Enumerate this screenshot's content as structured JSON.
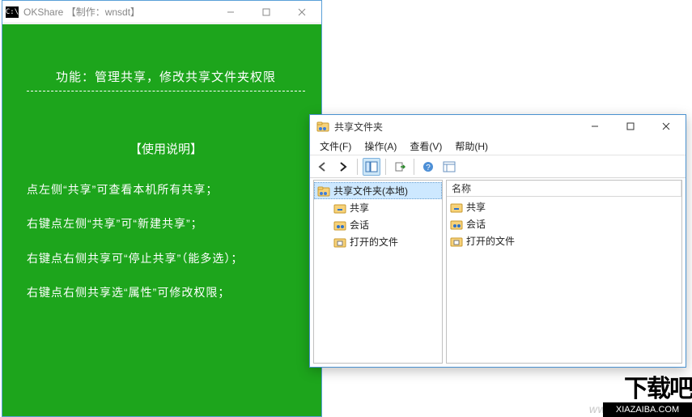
{
  "win1": {
    "title": "OKShare  【制作：wnsdt】",
    "heading": "功能：管理共享，修改共享文件夹权限",
    "usage_heading": "【使用说明】",
    "instructions": [
      "点左侧“共享”可查看本机所有共享；",
      "右键点左侧“共享”可“新建共享”；",
      "右键点右侧共享可“停止共享”（能多选）；",
      "右键点右侧共享选“属性”可修改权限；"
    ]
  },
  "win2": {
    "title": "共享文件夹",
    "menubar": [
      {
        "label": "文件(F)"
      },
      {
        "label": "操作(A)"
      },
      {
        "label": "查看(V)"
      },
      {
        "label": "帮助(H)"
      }
    ],
    "toolbar": [
      {
        "name": "back-icon"
      },
      {
        "name": "forward-icon"
      },
      {
        "sep": true
      },
      {
        "name": "show-hide-tree-icon",
        "selected": true
      },
      {
        "sep": true
      },
      {
        "name": "export-list-icon"
      },
      {
        "sep": true
      },
      {
        "name": "help-icon"
      },
      {
        "name": "properties-icon"
      }
    ],
    "tree": {
      "root": {
        "label": "共享文件夹(本地)",
        "selected": true,
        "icon": "shared-folder-icon"
      },
      "children": [
        {
          "label": "共享",
          "icon": "shares-icon"
        },
        {
          "label": "会话",
          "icon": "sessions-icon"
        },
        {
          "label": "打开的文件",
          "icon": "open-files-icon"
        }
      ]
    },
    "list": {
      "columns": [
        "名称"
      ],
      "items": [
        {
          "label": "共享",
          "icon": "shares-icon"
        },
        {
          "label": "会话",
          "icon": "sessions-icon"
        },
        {
          "label": "打开的文件",
          "icon": "open-files-icon"
        }
      ]
    }
  },
  "watermark": {
    "text": "www.xiazaiba.com",
    "logo_glyph": "下载吧",
    "logo_sub": "XIAZAIBA.COM"
  }
}
